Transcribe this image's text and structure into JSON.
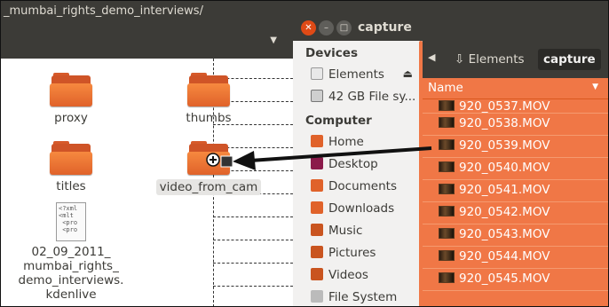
{
  "background_window": {
    "path_title": "_mumbai_rights_demo_interviews/",
    "items": [
      {
        "type": "folder",
        "label": "proxy"
      },
      {
        "type": "folder",
        "label": "thumbs"
      },
      {
        "type": "folder",
        "label": "titles"
      },
      {
        "type": "folder",
        "label": "video_from_cam"
      },
      {
        "type": "file",
        "label_lines": [
          "02_09_2011_",
          "mumbai_rights_",
          "demo_interviews.",
          "kdenlive"
        ],
        "icon_text": "<?xml\n<mlt\n <pro\n <pro"
      }
    ]
  },
  "foreground_window": {
    "title": "capture",
    "breadcrumb": {
      "parent": "Elements",
      "current": "capture"
    },
    "sidebar": {
      "devices_heading": "Devices",
      "devices": [
        {
          "label": "Elements",
          "icon": "usb-drive-icon"
        },
        {
          "label": "42 GB File sy...",
          "icon": "hard-disk-icon"
        }
      ],
      "computer_heading": "Computer",
      "places": [
        {
          "label": "Home",
          "icon": "home-folder-icon"
        },
        {
          "label": "Desktop",
          "icon": "desktop-icon"
        },
        {
          "label": "Documents",
          "icon": "documents-folder-icon"
        },
        {
          "label": "Downloads",
          "icon": "downloads-folder-icon"
        },
        {
          "label": "Music",
          "icon": "music-folder-icon"
        },
        {
          "label": "Pictures",
          "icon": "pictures-folder-icon"
        },
        {
          "label": "Videos",
          "icon": "videos-folder-icon"
        },
        {
          "label": "File System",
          "icon": "file-system-icon"
        }
      ]
    },
    "list_header": "Name",
    "files": [
      "920_0537.MOV",
      "920_0538.MOV",
      "920_0539.MOV",
      "920_0540.MOV",
      "920_0541.MOV",
      "920_0542.MOV",
      "920_0543.MOV",
      "920_0544.MOV",
      "920_0545.MOV"
    ]
  },
  "colors": {
    "accent": "#f07746",
    "titlebar": "#3c3b37",
    "close": "#df4a16"
  }
}
